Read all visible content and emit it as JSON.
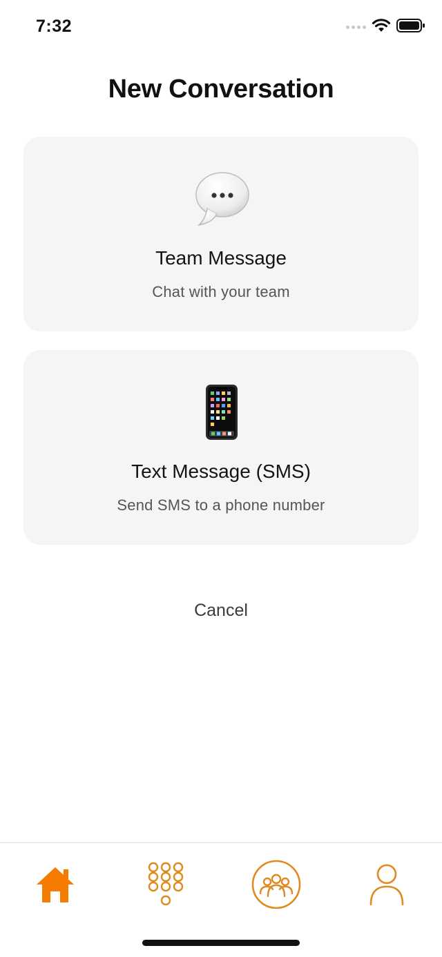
{
  "status_bar": {
    "time": "7:32",
    "icons": [
      "signal-dots-icon",
      "wifi-icon",
      "battery-icon"
    ]
  },
  "header": {
    "title": "New Conversation"
  },
  "options": [
    {
      "icon": "speech-bubble-icon",
      "title": "Team Message",
      "subtitle": "Chat with your team"
    },
    {
      "icon": "mobile-phone-icon",
      "title": "Text Message (SMS)",
      "subtitle": "Send SMS to a phone number"
    }
  ],
  "cancel_label": "Cancel",
  "tab_bar": {
    "tabs": [
      {
        "icon": "home-icon",
        "active": true
      },
      {
        "icon": "dialpad-icon",
        "active": false
      },
      {
        "icon": "team-group-icon",
        "active": false
      },
      {
        "icon": "profile-icon",
        "active": false
      }
    ]
  },
  "colors": {
    "accent": "#F57C00",
    "card_background": "#F5F5F5",
    "text_primary": "#111111",
    "text_secondary": "#555555"
  }
}
